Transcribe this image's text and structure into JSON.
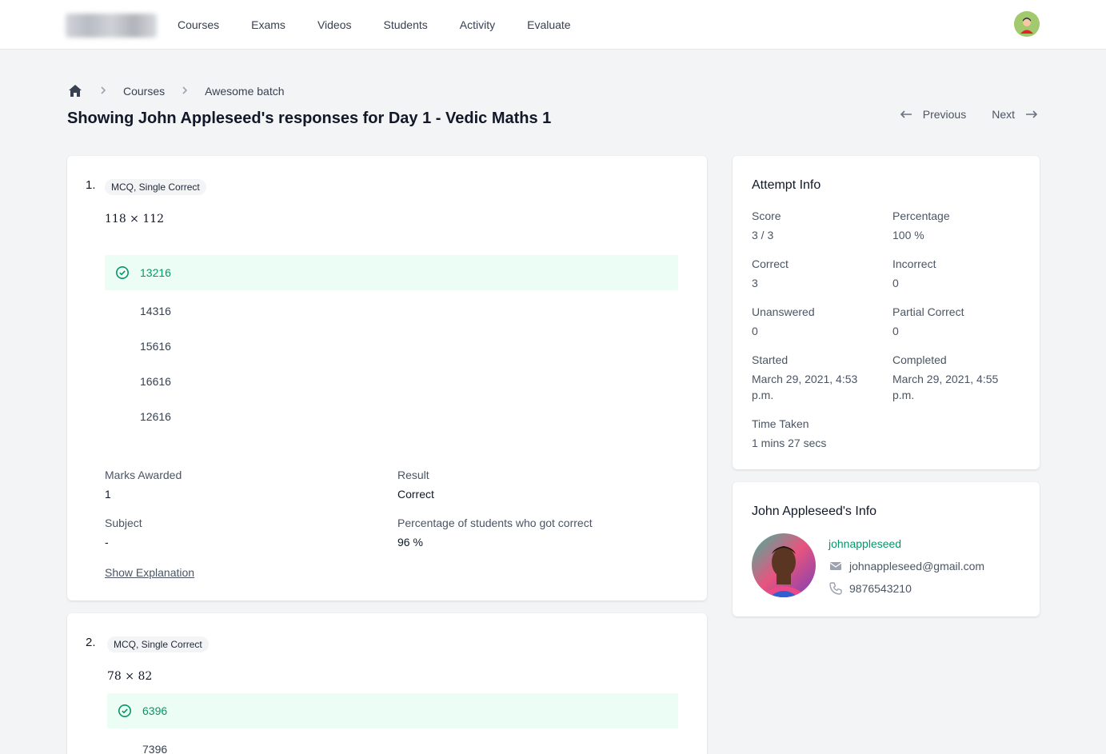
{
  "nav": {
    "links": [
      "Courses",
      "Exams",
      "Videos",
      "Students",
      "Activity",
      "Evaluate"
    ]
  },
  "breadcrumb": {
    "items": [
      "Courses",
      "Awesome batch"
    ]
  },
  "page": {
    "title": "Showing John Appleseed's responses for Day 1 - Vedic Maths 1",
    "previous_label": "Previous",
    "next_label": "Next"
  },
  "questions": [
    {
      "number": "1.",
      "type": "MCQ, Single Correct",
      "text": "118 × 112",
      "options": [
        "13216",
        "14316",
        "15616",
        "16616",
        "12616"
      ],
      "correct_option": "13216",
      "marks_label": "Marks Awarded",
      "marks": "1",
      "result_label": "Result",
      "result": "Correct",
      "subject_label": "Subject",
      "subject": "-",
      "pct_label": "Percentage of students who got correct",
      "pct": "96 %",
      "explanation_link": "Show Explanation"
    },
    {
      "number": "2.",
      "type": "MCQ, Single Correct",
      "text": "78 × 82",
      "options": [
        "6396",
        "7396"
      ],
      "correct_option": "6396"
    }
  ],
  "attempt": {
    "title": "Attempt Info",
    "score_label": "Score",
    "score": "3 / 3",
    "percentage_label": "Percentage",
    "percentage": "100 %",
    "correct_label": "Correct",
    "correct": "3",
    "incorrect_label": "Incorrect",
    "incorrect": "0",
    "unanswered_label": "Unanswered",
    "unanswered": "0",
    "partial_label": "Partial Correct",
    "partial": "0",
    "started_label": "Started",
    "started": "March 29, 2021, 4:53 p.m.",
    "completed_label": "Completed",
    "completed": "March 29, 2021, 4:55 p.m.",
    "time_label": "Time Taken",
    "time": "1 mins 27 secs"
  },
  "user": {
    "title": "John Appleseed's Info",
    "username": "johnappleseed",
    "email": "johnappleseed@gmail.com",
    "phone": "9876543210"
  },
  "colors": {
    "accent_green": "#059669",
    "correct_bg": "#ecfdf5",
    "page_bg": "#f3f4f6"
  },
  "icons": {
    "home": "home-icon",
    "chevron": "chevron-right-icon",
    "prev": "arrow-left-icon",
    "next": "arrow-right-icon",
    "check": "check-circle-icon",
    "mail": "mail-icon",
    "phone": "phone-icon"
  }
}
